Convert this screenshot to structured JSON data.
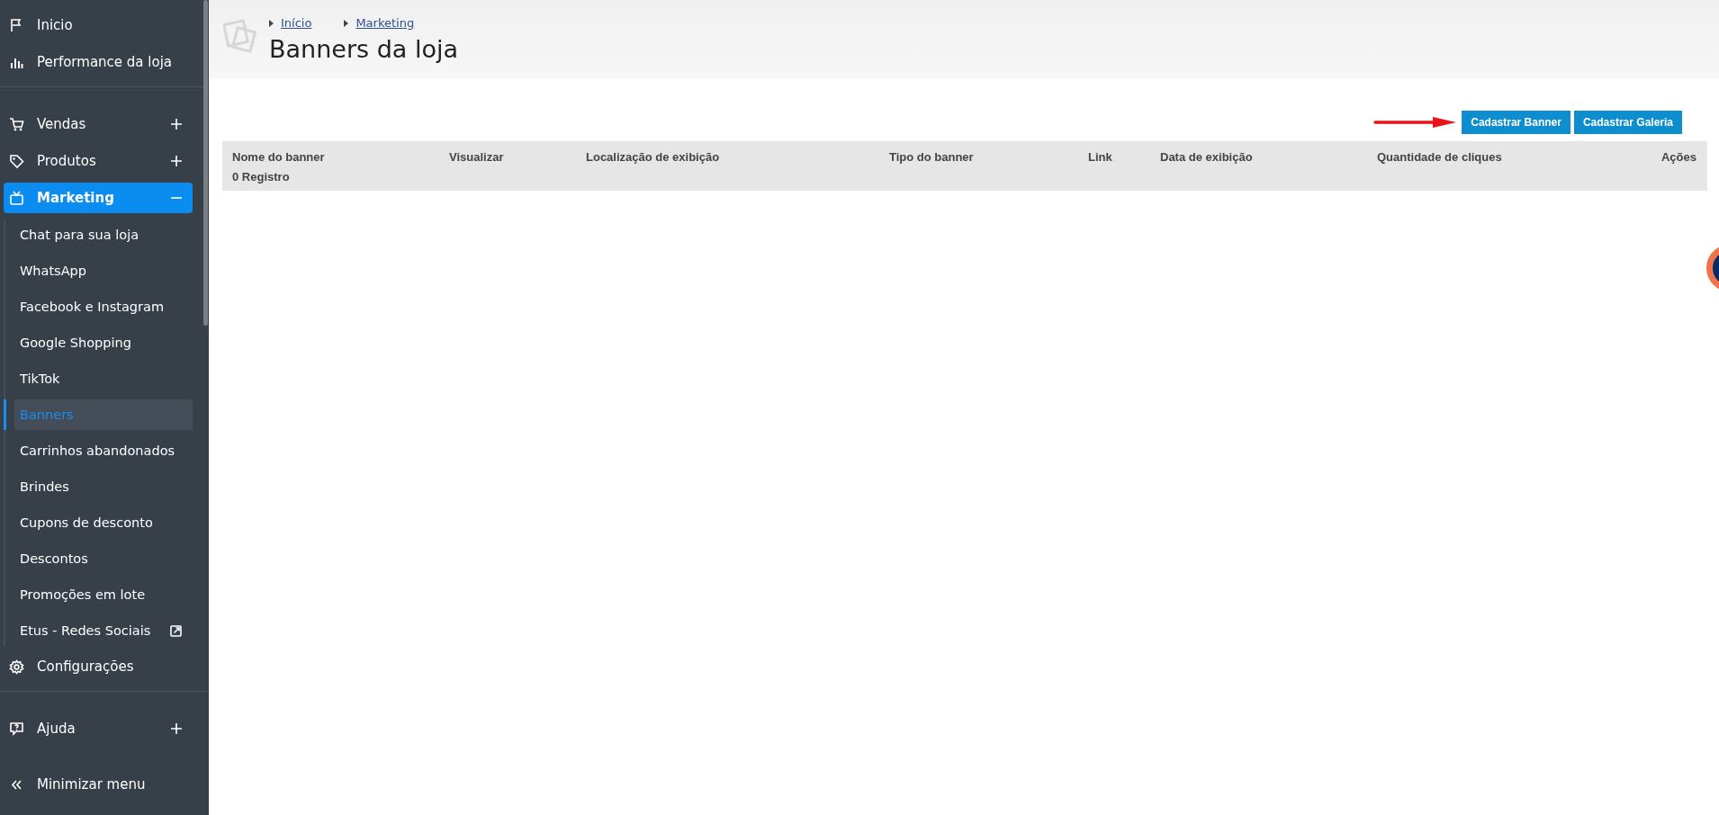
{
  "sidebar": {
    "items": [
      {
        "kind": "link",
        "label": "Inicio"
      },
      {
        "kind": "link",
        "label": "Performance da loja"
      },
      {
        "kind": "divider"
      },
      {
        "kind": "group",
        "label": "Vendas",
        "expanded": false,
        "selected": false
      },
      {
        "kind": "group",
        "label": "Produtos",
        "expanded": false,
        "selected": false
      },
      {
        "kind": "group",
        "label": "Marketing",
        "expanded": true,
        "selected": true,
        "children": [
          {
            "label": "Chat para sua loja",
            "selected": false
          },
          {
            "label": "WhatsApp",
            "selected": false
          },
          {
            "label": "Facebook e Instagram",
            "selected": false
          },
          {
            "label": "Google Shopping",
            "selected": false
          },
          {
            "label": "TikTok",
            "selected": false
          },
          {
            "label": "Banners",
            "selected": true
          },
          {
            "label": "Carrinhos abandonados",
            "selected": false
          },
          {
            "label": "Brindes",
            "selected": false
          },
          {
            "label": "Cupons de desconto",
            "selected": false
          },
          {
            "label": "Descontos",
            "selected": false
          },
          {
            "label": "Promoções em lote",
            "selected": false
          },
          {
            "label": "Etus - Redes Sociais",
            "selected": false,
            "external": true
          }
        ]
      },
      {
        "kind": "link",
        "label": "Configurações"
      },
      {
        "kind": "divider"
      },
      {
        "kind": "group",
        "label": "Ajuda",
        "expanded": false,
        "selected": false
      },
      {
        "kind": "minimize",
        "label": "Minimizar menu"
      }
    ]
  },
  "breadcrumb": [
    "Início",
    "Marketing"
  ],
  "page_title": "Banners da loja",
  "buttons": [
    "Cadastrar Banner",
    "Cadastrar Galeria"
  ],
  "table": {
    "columns": [
      "Nome do banner",
      "Visualizar",
      "Localização de exibição",
      "Tipo do banner",
      "Link",
      "Data de exibição",
      "Quantidade de cliques",
      "Ações"
    ],
    "footer": "0 Registro"
  }
}
